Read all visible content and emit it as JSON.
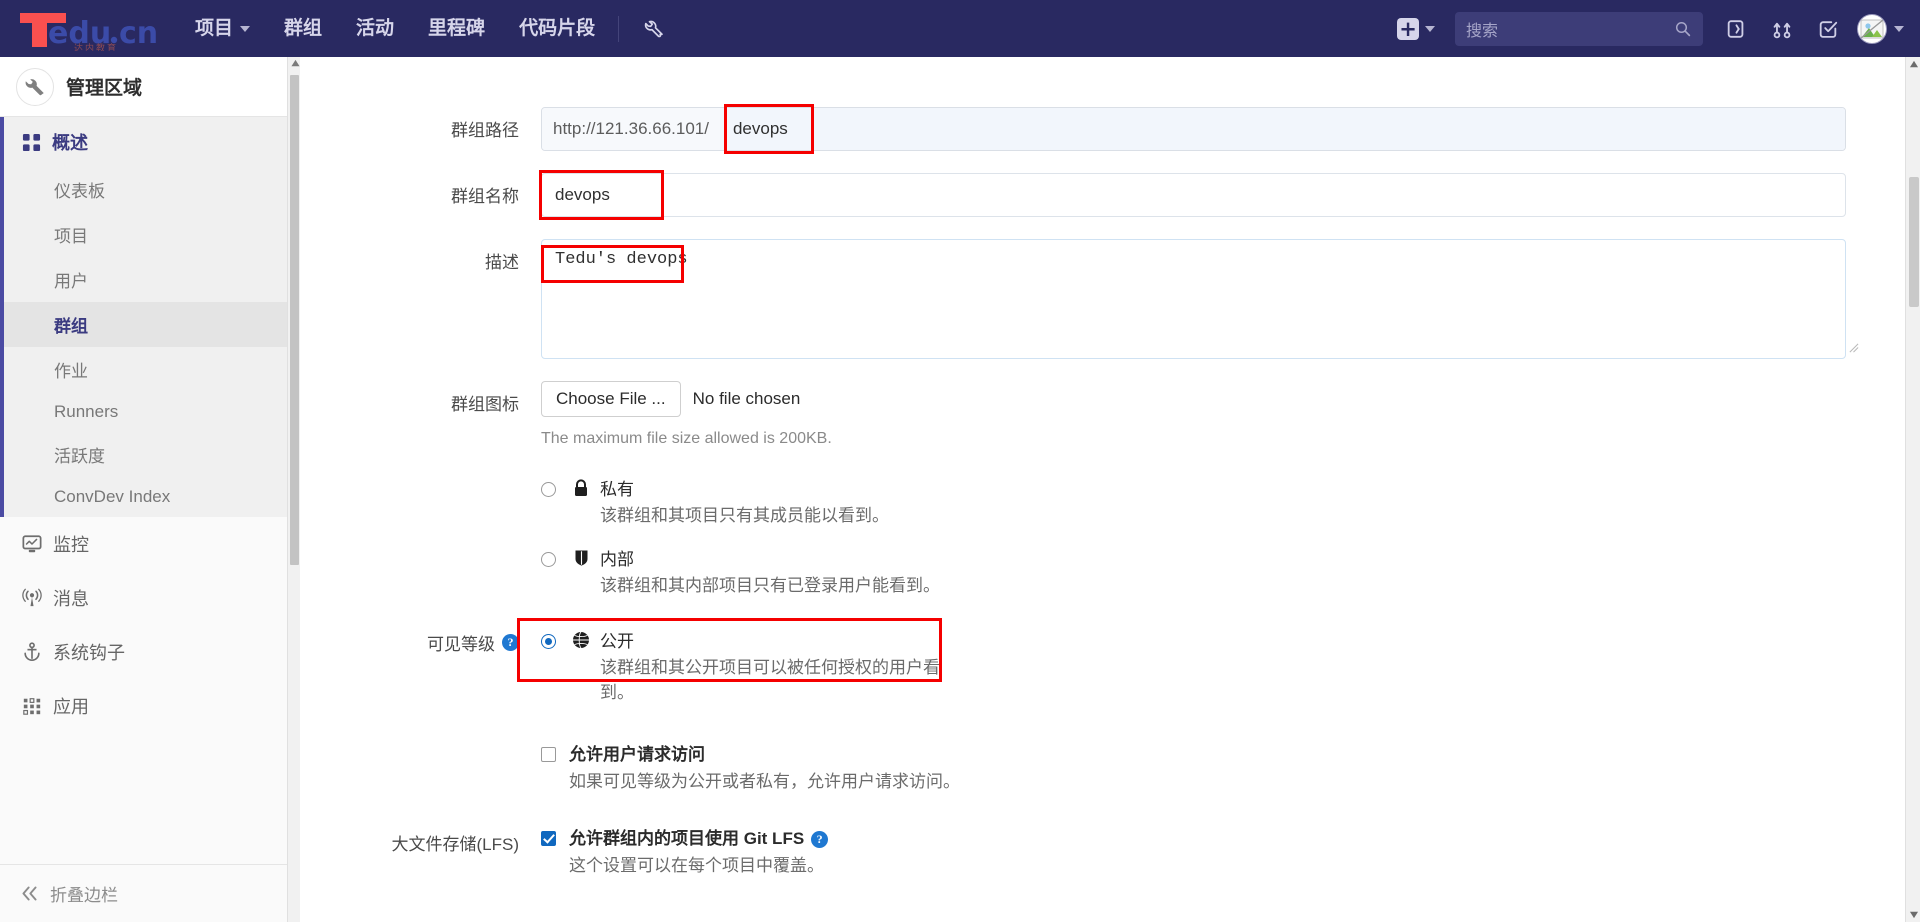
{
  "topnav": {
    "logo": {
      "brand_red": "T",
      "brand_blue": "edu.cn",
      "subtitle": "达内教育"
    },
    "links": [
      {
        "label": "项目",
        "has_caret": true
      },
      {
        "label": "群组",
        "has_caret": false
      },
      {
        "label": "活动",
        "has_caret": false
      },
      {
        "label": "里程碑",
        "has_caret": false
      },
      {
        "label": "代码片段",
        "has_caret": false
      }
    ],
    "admin_wrench_icon": "wrench-icon",
    "plus_label": "+",
    "search_placeholder": "搜索",
    "icons": [
      "issues-icon",
      "merge-request-icon",
      "todos-icon"
    ],
    "avatar_icon": "user-avatar"
  },
  "sidebar": {
    "title": "管理区域",
    "title_icon": "wrench-icon",
    "overview": {
      "label": "概述",
      "icon": "overview-grid-icon"
    },
    "sub_items": [
      {
        "label": "仪表板",
        "active": false
      },
      {
        "label": "项目",
        "active": false
      },
      {
        "label": "用户",
        "active": false
      },
      {
        "label": "群组",
        "active": true
      },
      {
        "label": "作业",
        "active": false
      },
      {
        "label": "Runners",
        "active": false
      },
      {
        "label": "活跃度",
        "active": false
      },
      {
        "label": "ConvDev Index",
        "active": false
      }
    ],
    "main_items": [
      {
        "label": "监控",
        "icon": "monitor-icon"
      },
      {
        "label": "消息",
        "icon": "broadcast-icon"
      },
      {
        "label": "系统钩子",
        "icon": "hook-icon"
      },
      {
        "label": "应用",
        "icon": "applications-icon"
      }
    ],
    "collapse": {
      "label": "折叠边栏",
      "icon": "chevron-double-left-icon"
    }
  },
  "form": {
    "group_path": {
      "label": "群组路径",
      "prefix": "http://121.36.66.101/",
      "value": "devops",
      "highlighted": true
    },
    "group_name": {
      "label": "群组名称",
      "value": "devops",
      "highlighted": true
    },
    "description": {
      "label": "描述",
      "value": "Tedu's devops",
      "highlighted": true
    },
    "group_avatar": {
      "label": "群组图标",
      "button_label": "Choose File ...",
      "file_status": "No file chosen",
      "hint": "The maximum file size allowed is 200KB."
    },
    "visibility": {
      "label": "可见等级",
      "help_icon": "question-mark-icon",
      "options": [
        {
          "title": "私有",
          "desc": "该群组和其项目只有其成员能以看到。",
          "icon": "lock-icon",
          "selected": false,
          "highlighted": false
        },
        {
          "title": "内部",
          "desc": "该群组和其内部项目只有已登录用户能看到。",
          "icon": "shield-icon",
          "selected": false,
          "highlighted": false
        },
        {
          "title": "公开",
          "desc": "该群组和其公开项目可以被任何授权的用户看到。",
          "icon": "globe-icon",
          "selected": true,
          "highlighted": true
        }
      ]
    },
    "request_access": {
      "title": "允许用户请求访问",
      "desc": "如果可见等级为公开或者私有，允许用户请求访问。",
      "checked": false
    },
    "lfs": {
      "label": "大文件存储(LFS)",
      "title": "允许群组内的项目使用 Git LFS",
      "help_icon": "question-mark-icon",
      "desc": "这个设置可以在每个项目中覆盖。",
      "checked": true
    }
  },
  "colors": {
    "nav_bg": "#292961",
    "brand_red": "#f9504f",
    "brand_blue": "#3b4ba8",
    "accent_blue": "#1068bf",
    "annotation_red": "#f50000",
    "sidebar_bg": "#fafafa",
    "active_item": "#4b4ba3"
  }
}
